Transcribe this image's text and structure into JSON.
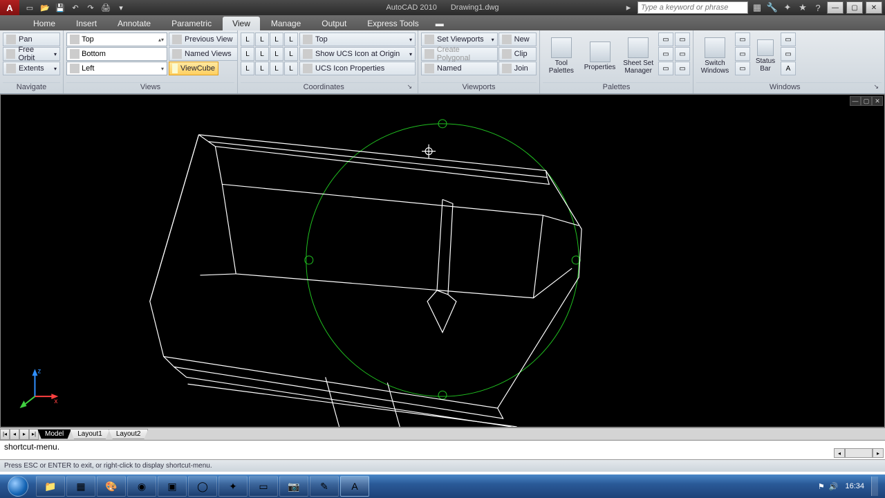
{
  "titlebar": {
    "app_name": "AutoCAD 2010",
    "doc_name": "Drawing1.dwg",
    "search_placeholder": "Type a keyword or phrase"
  },
  "tabs": {
    "items": [
      "Home",
      "Insert",
      "Annotate",
      "Parametric",
      "View",
      "Manage",
      "Output",
      "Express Tools"
    ],
    "active": "View"
  },
  "ribbon": {
    "navigate": {
      "title": "Navigate",
      "pan": "Pan",
      "free_orbit": "Free Orbit",
      "extents": "Extents"
    },
    "views": {
      "title": "Views",
      "top": "Top",
      "bottom": "Bottom",
      "left": "Left",
      "prev": "Previous View",
      "named_views": "Named Views",
      "viewcube": "ViewCube"
    },
    "coordinates": {
      "title": "Coordinates",
      "combo_label": "Top",
      "show_ucs": "Show UCS Icon at Origin",
      "ucs_props": "UCS Icon Properties"
    },
    "viewports": {
      "title": "Viewports",
      "set": "Set Viewports",
      "new": "New",
      "create_poly": "Create Polygonal",
      "clip": "Clip",
      "named": "Named",
      "join": "Join"
    },
    "palettes": {
      "title": "Palettes",
      "tool": "Tool Palettes",
      "props": "Properties",
      "ssm": "Sheet Set Manager"
    },
    "windows": {
      "title": "Windows",
      "switch": "Switch Windows",
      "status": "Status Bar"
    }
  },
  "layout_tabs": {
    "items": [
      "Model",
      "Layout1",
      "Layout2"
    ],
    "active": "Model"
  },
  "command": {
    "text": "shortcut-menu."
  },
  "status": {
    "text": "Press ESC or ENTER to exit, or right-click to display shortcut-menu."
  },
  "taskbar": {
    "time": "16:34"
  }
}
